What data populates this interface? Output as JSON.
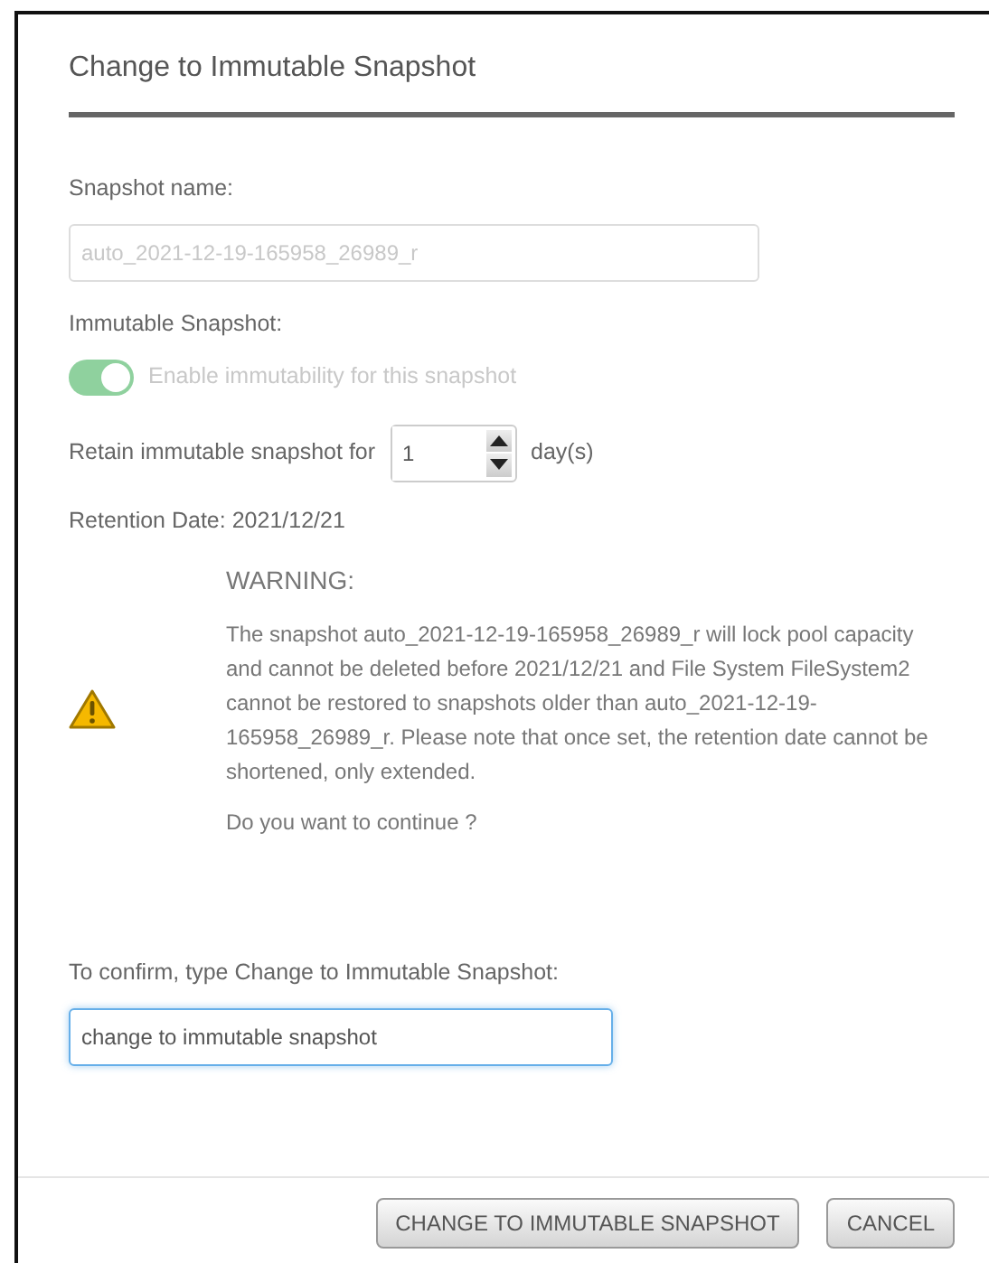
{
  "dialog": {
    "title": "Change to Immutable Snapshot"
  },
  "snapshot_name": {
    "label": "Snapshot name:",
    "value": "auto_2021-12-19-165958_26989_r",
    "disabled": true
  },
  "immutable": {
    "label": "Immutable Snapshot:",
    "toggle_label": "Enable immutability for this snapshot",
    "on": true,
    "disabled": true
  },
  "retain": {
    "label": "Retain immutable snapshot for",
    "value": "1",
    "unit": "day(s)"
  },
  "retention_date": "Retention Date: 2021/12/21",
  "warning": {
    "title": "WARNING:",
    "message": "The snapshot auto_2021-12-19-165958_26989_r will lock pool capacity and cannot be deleted before 2021/12/21 and File System FileSystem2 cannot be restored to snapshots older than auto_2021-12-19-165958_26989_r. Please note that once set, the retention date cannot be shortened, only extended.",
    "question": "Do you want to continue ?"
  },
  "confirm": {
    "label": "To confirm, type Change to Immutable Snapshot:",
    "value": "change to immutable snapshot",
    "focused": true
  },
  "buttons": [
    {
      "label": "CHANGE TO IMMUTABLE SNAPSHOT"
    },
    {
      "label": "CANCEL"
    }
  ]
}
